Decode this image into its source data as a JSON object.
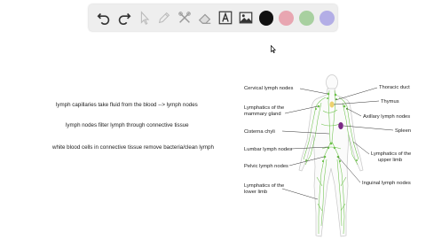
{
  "toolbar": {
    "tools": [
      {
        "name": "undo-icon",
        "interactable": true
      },
      {
        "name": "redo-icon",
        "interactable": true
      },
      {
        "name": "select-pointer-icon",
        "interactable": true
      },
      {
        "name": "pen-icon",
        "interactable": true
      },
      {
        "name": "tools-icon",
        "interactable": true
      },
      {
        "name": "eraser-icon",
        "interactable": true
      },
      {
        "name": "text-tool-icon",
        "interactable": true
      },
      {
        "name": "image-tool-icon",
        "interactable": true
      }
    ],
    "colors": [
      "#111111",
      "#e8a6b1",
      "#a8d0a0",
      "#b3aee6"
    ]
  },
  "notes": {
    "line1": "lymph capillaries take fluid from the blood --> lymph nodes",
    "line2": "lymph nodes filter lymph through connective tissue",
    "line3": "white blood cells in connective tissue remove bacteria/clean lymph"
  },
  "figure": {
    "left_labels": {
      "cervical": "Cervical lymph nodes",
      "mammary_1": "Lymphatics of the",
      "mammary_2": "mammary gland",
      "cisterna": "Cisterna chyli",
      "lumbar": "Lumbar lymph nodes",
      "pelvic": "Pelvic lymph nodes",
      "lower_1": "Lymphatics of the",
      "lower_2": "lower limb"
    },
    "right_labels": {
      "thoracic": "Thoracic duct",
      "thymus": "Thymus",
      "axillary": "Axillary lymph nodes",
      "spleen": "Spleen",
      "upper_1": "Lymphatics of the",
      "upper_2": "upper limb",
      "inguinal": "Inguinal lymph nodes"
    },
    "colors": {
      "lymph": "#6cc24a",
      "spleen": "#7b2a86",
      "outline": "#c8c8c8"
    }
  }
}
